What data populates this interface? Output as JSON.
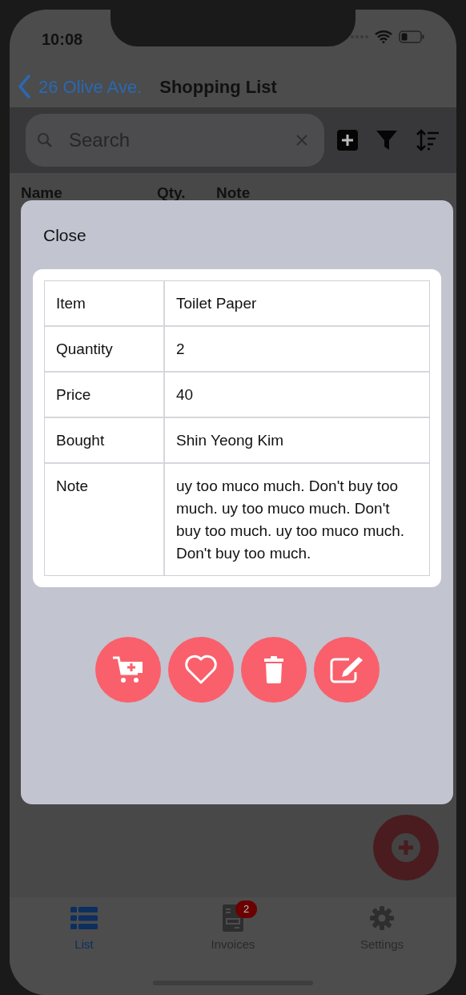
{
  "status_bar": {
    "time": "10:08"
  },
  "nav": {
    "back": "26 Olive Ave.",
    "title": "Shopping List"
  },
  "search": {
    "placeholder": "Search"
  },
  "toolbar": [
    {
      "kind": "add"
    },
    {
      "kind": "filter"
    },
    {
      "kind": "sort"
    }
  ],
  "table_header": [
    "Name",
    "Qty.",
    "Note"
  ],
  "modal": {
    "close": "Close",
    "rows": [
      {
        "label": "Item",
        "value": "Toilet Paper"
      },
      {
        "label": "Quantity",
        "value": "2"
      },
      {
        "label": "Price",
        "value": "40"
      },
      {
        "label": "Bought",
        "value": "Shin Yeong Kim"
      },
      {
        "label": "Note",
        "value": "uy too muco much. Don't buy too much. uy too muco much. Don't buy too much. uy too muco much. Don't buy too much."
      }
    ],
    "actions": [
      {
        "kind": "cart"
      },
      {
        "kind": "heart"
      },
      {
        "kind": "trash"
      },
      {
        "kind": "edit"
      }
    ]
  },
  "tabs": [
    {
      "label": "List",
      "kind": "list",
      "selected": true
    },
    {
      "label": "Invoices",
      "kind": "invoice",
      "selected": false,
      "badge": "2"
    },
    {
      "label": "Settings",
      "kind": "gear",
      "selected": false
    }
  ]
}
